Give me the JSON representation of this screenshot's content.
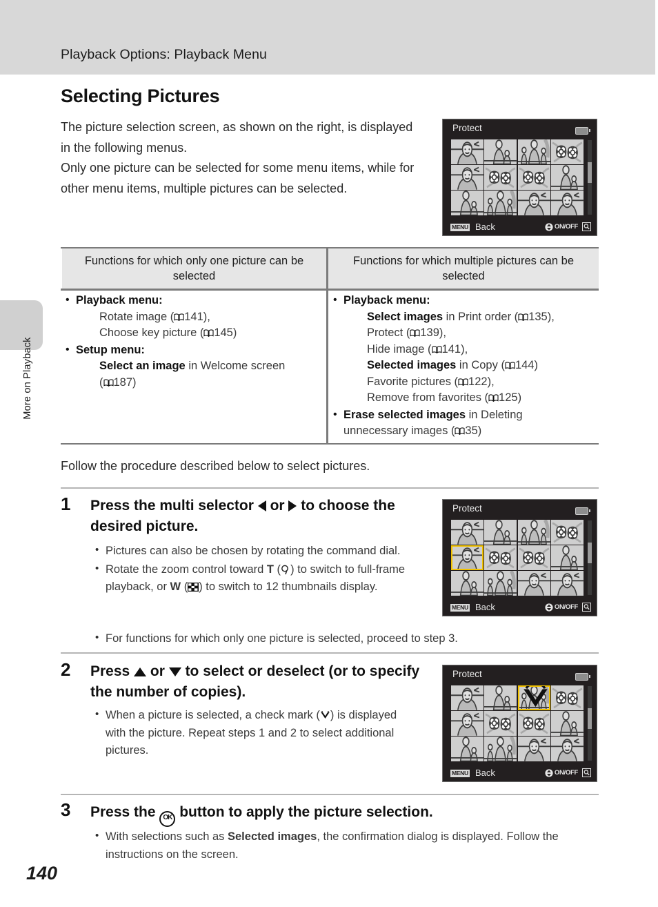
{
  "header": {
    "running_title": "Playback Options: Playback Menu"
  },
  "sidebar": {
    "tab_label": "More on Playback"
  },
  "page": {
    "number": "140"
  },
  "section": {
    "heading": "Selecting Pictures",
    "intro_line1": "The picture selection screen, as shown on the right, is displayed in the following menus.",
    "intro_line2": "Only one picture can be selected for some menu items, while for other menu items, multiple pictures can be selected.",
    "follow_text": "Follow the procedure described below to select pictures."
  },
  "table": {
    "header_left": "Functions for which only one picture can be selected",
    "header_right": "Functions for which multiple pictures can be selected",
    "left_items": [
      {
        "title": "Playback menu:",
        "lines": [
          "Rotate image (A141),",
          "Choose key picture (A145)"
        ]
      },
      {
        "title": "Setup menu:",
        "lines": [
          "Select an image in Welcome screen (A187)"
        ]
      }
    ],
    "right_items": [
      {
        "title": "Playback menu:",
        "lines": [
          "Select images in Print order (A135),",
          "Protect (A139),",
          "Hide image (A141),",
          "Selected images in Copy (A144)",
          "Favorite pictures (A122),",
          "Remove from favorites (A125)"
        ]
      },
      {
        "title": "Erase selected images in Deleting unnecessary images (A35)",
        "lines": []
      }
    ],
    "left_plain": {
      "l1_title": "Playback menu:",
      "l1a": "Rotate image (",
      "l1a_ref": "141),",
      "l1b": "Choose key picture (",
      "l1b_ref": "145)",
      "l2_title": "Setup menu:",
      "l2a_bold": "Select an image",
      "l2a_rest": " in Welcome screen",
      "l2b": "(",
      "l2b_ref": "187)"
    },
    "right_plain": {
      "r1_title": "Playback menu:",
      "r1a_bold": "Select images",
      "r1a_rest": " in Print order (",
      "r1a_ref": "135),",
      "r1b": "Protect (",
      "r1b_ref": "139),",
      "r1c": "Hide image (",
      "r1c_ref": "141),",
      "r1d_bold": "Selected images",
      "r1d_rest": " in Copy (",
      "r1d_ref": "144)",
      "r1e": "Favorite pictures (",
      "r1e_ref": "122),",
      "r1f": "Remove from favorites (",
      "r1f_ref": "125)",
      "r2_bold": "Erase selected images",
      "r2_rest": " in Deleting",
      "r2b": "unnecessary images (",
      "r2b_ref": "35)"
    }
  },
  "steps": [
    {
      "num": "1",
      "title_a": "Press the multi selector ",
      "title_or": " or ",
      "title_b": " to choose the desired picture.",
      "bullets": {
        "b1": "Pictures can also be chosen by rotating the command dial.",
        "b2a": "Rotate the zoom control toward ",
        "b2_T": "T",
        "b2b": " (",
        "b2c": ") to switch to full-frame playback, or ",
        "b2_W": "W",
        "b2d": " (",
        "b2e": ") to switch to 12 thumbnails display.",
        "b3": "For functions for which only one picture is selected, proceed to step 3."
      }
    },
    {
      "num": "2",
      "title_a": "Press ",
      "title_or": " or ",
      "title_b": " to select or deselect (or to specify the number of copies).",
      "bullets": {
        "b1a": "When a picture is selected, a check mark (",
        "b1b": ") is displayed with the picture. Repeat steps 1 and 2 to select additional pictures."
      }
    },
    {
      "num": "3",
      "title_a": "Press the ",
      "title_b": " button to apply the picture selection.",
      "ok_label": "OK",
      "bullets": {
        "b1a": "With selections such as ",
        "b1_bold": "Selected images",
        "b1b": ", the confirmation dialog is displayed. Follow the instructions on the screen."
      }
    }
  ],
  "lcd_screens": [
    {
      "title": "Protect",
      "back_chip": "MENU",
      "back_label": "Back",
      "onoff_label": "ON/OFF",
      "selected_index": null,
      "checked_indices": []
    },
    {
      "title": "Protect",
      "back_chip": "MENU",
      "back_label": "Back",
      "onoff_label": "ON/OFF",
      "selected_index": 4,
      "checked_indices": []
    },
    {
      "title": "Protect",
      "back_chip": "MENU",
      "back_label": "Back",
      "onoff_label": "ON/OFF",
      "selected_index": 2,
      "checked_indices": [
        2
      ]
    }
  ],
  "colors": {
    "header_band": "#d8d8d8",
    "table_header": "#e6e6e6",
    "rule": "#7b7b7b",
    "lcd_bg": "#231f20",
    "selection": "#f2c200"
  }
}
